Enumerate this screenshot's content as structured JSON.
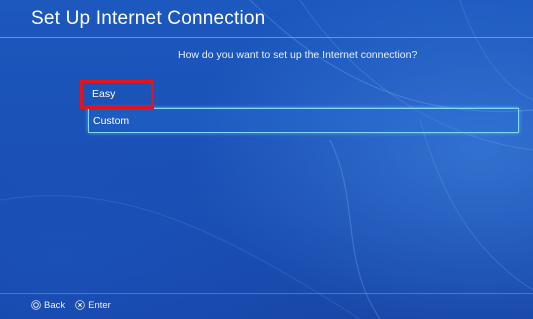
{
  "header": {
    "title": "Set Up Internet Connection"
  },
  "main": {
    "question": "How do you want to set up the Internet connection?",
    "options": [
      {
        "label": "Easy",
        "highlighted": true
      },
      {
        "label": "Custom",
        "focused": true
      }
    ]
  },
  "footer": {
    "hints": [
      {
        "icon": "circle-button-icon",
        "label": "Back"
      },
      {
        "icon": "cross-button-icon",
        "label": "Enter"
      }
    ]
  },
  "colors": {
    "background": "#1a52b8",
    "focus_border": "#7fd6ff",
    "highlight_red": "#e3141f",
    "text": "#ffffff"
  }
}
